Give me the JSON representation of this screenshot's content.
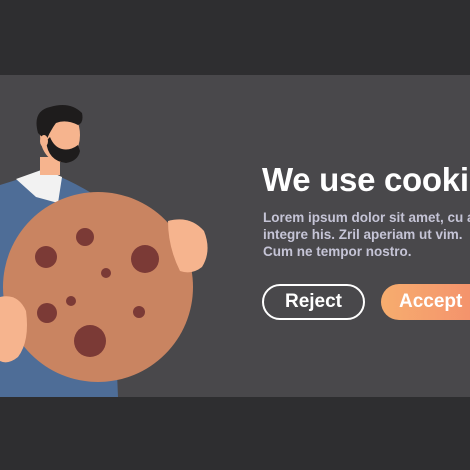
{
  "cookie_banner": {
    "title": "We use cookie",
    "body_lines": [
      "Lorem ipsum dolor sit amet, cu a",
      "integre his. Zril aperiam ut vim.",
      "Cum ne tempor nostro."
    ],
    "reject_label": "Reject",
    "accept_label": "Accept"
  },
  "colors": {
    "page_background": "#2e2e30",
    "banner_background": "#49484b",
    "cookie": "#c98461",
    "chocolate_chip": "#7b3a36",
    "shirt": "#4e6d97",
    "skin": "#f6b48e",
    "hair": "#1e1c1c",
    "accept_gradient_start": "#f6ad6e",
    "accept_gradient_end": "#f48d6c"
  }
}
